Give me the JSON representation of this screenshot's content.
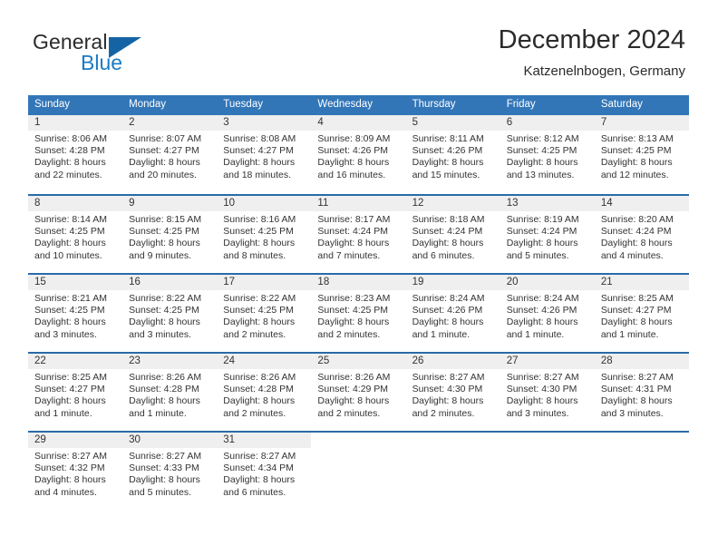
{
  "brand": {
    "name_part1": "General",
    "name_part2": "Blue",
    "accent_color": "#1464a5",
    "blue_text_color": "#1a7bc4"
  },
  "header": {
    "title": "December 2024",
    "subtitle": "Katzenelnbogen, Germany"
  },
  "calendar": {
    "header_bg": "#3276b8",
    "row_divider_color": "#2a6ba8",
    "day_number_bg": "#efefef",
    "weekdays": [
      "Sunday",
      "Monday",
      "Tuesday",
      "Wednesday",
      "Thursday",
      "Friday",
      "Saturday"
    ],
    "weeks": [
      [
        {
          "day": "1",
          "sunrise": "Sunrise: 8:06 AM",
          "sunset": "Sunset: 4:28 PM",
          "daylight_line1": "Daylight: 8 hours",
          "daylight_line2": "and 22 minutes."
        },
        {
          "day": "2",
          "sunrise": "Sunrise: 8:07 AM",
          "sunset": "Sunset: 4:27 PM",
          "daylight_line1": "Daylight: 8 hours",
          "daylight_line2": "and 20 minutes."
        },
        {
          "day": "3",
          "sunrise": "Sunrise: 8:08 AM",
          "sunset": "Sunset: 4:27 PM",
          "daylight_line1": "Daylight: 8 hours",
          "daylight_line2": "and 18 minutes."
        },
        {
          "day": "4",
          "sunrise": "Sunrise: 8:09 AM",
          "sunset": "Sunset: 4:26 PM",
          "daylight_line1": "Daylight: 8 hours",
          "daylight_line2": "and 16 minutes."
        },
        {
          "day": "5",
          "sunrise": "Sunrise: 8:11 AM",
          "sunset": "Sunset: 4:26 PM",
          "daylight_line1": "Daylight: 8 hours",
          "daylight_line2": "and 15 minutes."
        },
        {
          "day": "6",
          "sunrise": "Sunrise: 8:12 AM",
          "sunset": "Sunset: 4:25 PM",
          "daylight_line1": "Daylight: 8 hours",
          "daylight_line2": "and 13 minutes."
        },
        {
          "day": "7",
          "sunrise": "Sunrise: 8:13 AM",
          "sunset": "Sunset: 4:25 PM",
          "daylight_line1": "Daylight: 8 hours",
          "daylight_line2": "and 12 minutes."
        }
      ],
      [
        {
          "day": "8",
          "sunrise": "Sunrise: 8:14 AM",
          "sunset": "Sunset: 4:25 PM",
          "daylight_line1": "Daylight: 8 hours",
          "daylight_line2": "and 10 minutes."
        },
        {
          "day": "9",
          "sunrise": "Sunrise: 8:15 AM",
          "sunset": "Sunset: 4:25 PM",
          "daylight_line1": "Daylight: 8 hours",
          "daylight_line2": "and 9 minutes."
        },
        {
          "day": "10",
          "sunrise": "Sunrise: 8:16 AM",
          "sunset": "Sunset: 4:25 PM",
          "daylight_line1": "Daylight: 8 hours",
          "daylight_line2": "and 8 minutes."
        },
        {
          "day": "11",
          "sunrise": "Sunrise: 8:17 AM",
          "sunset": "Sunset: 4:24 PM",
          "daylight_line1": "Daylight: 8 hours",
          "daylight_line2": "and 7 minutes."
        },
        {
          "day": "12",
          "sunrise": "Sunrise: 8:18 AM",
          "sunset": "Sunset: 4:24 PM",
          "daylight_line1": "Daylight: 8 hours",
          "daylight_line2": "and 6 minutes."
        },
        {
          "day": "13",
          "sunrise": "Sunrise: 8:19 AM",
          "sunset": "Sunset: 4:24 PM",
          "daylight_line1": "Daylight: 8 hours",
          "daylight_line2": "and 5 minutes."
        },
        {
          "day": "14",
          "sunrise": "Sunrise: 8:20 AM",
          "sunset": "Sunset: 4:24 PM",
          "daylight_line1": "Daylight: 8 hours",
          "daylight_line2": "and 4 minutes."
        }
      ],
      [
        {
          "day": "15",
          "sunrise": "Sunrise: 8:21 AM",
          "sunset": "Sunset: 4:25 PM",
          "daylight_line1": "Daylight: 8 hours",
          "daylight_line2": "and 3 minutes."
        },
        {
          "day": "16",
          "sunrise": "Sunrise: 8:22 AM",
          "sunset": "Sunset: 4:25 PM",
          "daylight_line1": "Daylight: 8 hours",
          "daylight_line2": "and 3 minutes."
        },
        {
          "day": "17",
          "sunrise": "Sunrise: 8:22 AM",
          "sunset": "Sunset: 4:25 PM",
          "daylight_line1": "Daylight: 8 hours",
          "daylight_line2": "and 2 minutes."
        },
        {
          "day": "18",
          "sunrise": "Sunrise: 8:23 AM",
          "sunset": "Sunset: 4:25 PM",
          "daylight_line1": "Daylight: 8 hours",
          "daylight_line2": "and 2 minutes."
        },
        {
          "day": "19",
          "sunrise": "Sunrise: 8:24 AM",
          "sunset": "Sunset: 4:26 PM",
          "daylight_line1": "Daylight: 8 hours",
          "daylight_line2": "and 1 minute."
        },
        {
          "day": "20",
          "sunrise": "Sunrise: 8:24 AM",
          "sunset": "Sunset: 4:26 PM",
          "daylight_line1": "Daylight: 8 hours",
          "daylight_line2": "and 1 minute."
        },
        {
          "day": "21",
          "sunrise": "Sunrise: 8:25 AM",
          "sunset": "Sunset: 4:27 PM",
          "daylight_line1": "Daylight: 8 hours",
          "daylight_line2": "and 1 minute."
        }
      ],
      [
        {
          "day": "22",
          "sunrise": "Sunrise: 8:25 AM",
          "sunset": "Sunset: 4:27 PM",
          "daylight_line1": "Daylight: 8 hours",
          "daylight_line2": "and 1 minute."
        },
        {
          "day": "23",
          "sunrise": "Sunrise: 8:26 AM",
          "sunset": "Sunset: 4:28 PM",
          "daylight_line1": "Daylight: 8 hours",
          "daylight_line2": "and 1 minute."
        },
        {
          "day": "24",
          "sunrise": "Sunrise: 8:26 AM",
          "sunset": "Sunset: 4:28 PM",
          "daylight_line1": "Daylight: 8 hours",
          "daylight_line2": "and 2 minutes."
        },
        {
          "day": "25",
          "sunrise": "Sunrise: 8:26 AM",
          "sunset": "Sunset: 4:29 PM",
          "daylight_line1": "Daylight: 8 hours",
          "daylight_line2": "and 2 minutes."
        },
        {
          "day": "26",
          "sunrise": "Sunrise: 8:27 AM",
          "sunset": "Sunset: 4:30 PM",
          "daylight_line1": "Daylight: 8 hours",
          "daylight_line2": "and 2 minutes."
        },
        {
          "day": "27",
          "sunrise": "Sunrise: 8:27 AM",
          "sunset": "Sunset: 4:30 PM",
          "daylight_line1": "Daylight: 8 hours",
          "daylight_line2": "and 3 minutes."
        },
        {
          "day": "28",
          "sunrise": "Sunrise: 8:27 AM",
          "sunset": "Sunset: 4:31 PM",
          "daylight_line1": "Daylight: 8 hours",
          "daylight_line2": "and 3 minutes."
        }
      ],
      [
        {
          "day": "29",
          "sunrise": "Sunrise: 8:27 AM",
          "sunset": "Sunset: 4:32 PM",
          "daylight_line1": "Daylight: 8 hours",
          "daylight_line2": "and 4 minutes."
        },
        {
          "day": "30",
          "sunrise": "Sunrise: 8:27 AM",
          "sunset": "Sunset: 4:33 PM",
          "daylight_line1": "Daylight: 8 hours",
          "daylight_line2": "and 5 minutes."
        },
        {
          "day": "31",
          "sunrise": "Sunrise: 8:27 AM",
          "sunset": "Sunset: 4:34 PM",
          "daylight_line1": "Daylight: 8 hours",
          "daylight_line2": "and 6 minutes."
        },
        {
          "day": "",
          "sunrise": "",
          "sunset": "",
          "daylight_line1": "",
          "daylight_line2": ""
        },
        {
          "day": "",
          "sunrise": "",
          "sunset": "",
          "daylight_line1": "",
          "daylight_line2": ""
        },
        {
          "day": "",
          "sunrise": "",
          "sunset": "",
          "daylight_line1": "",
          "daylight_line2": ""
        },
        {
          "day": "",
          "sunrise": "",
          "sunset": "",
          "daylight_line1": "",
          "daylight_line2": ""
        }
      ]
    ]
  }
}
